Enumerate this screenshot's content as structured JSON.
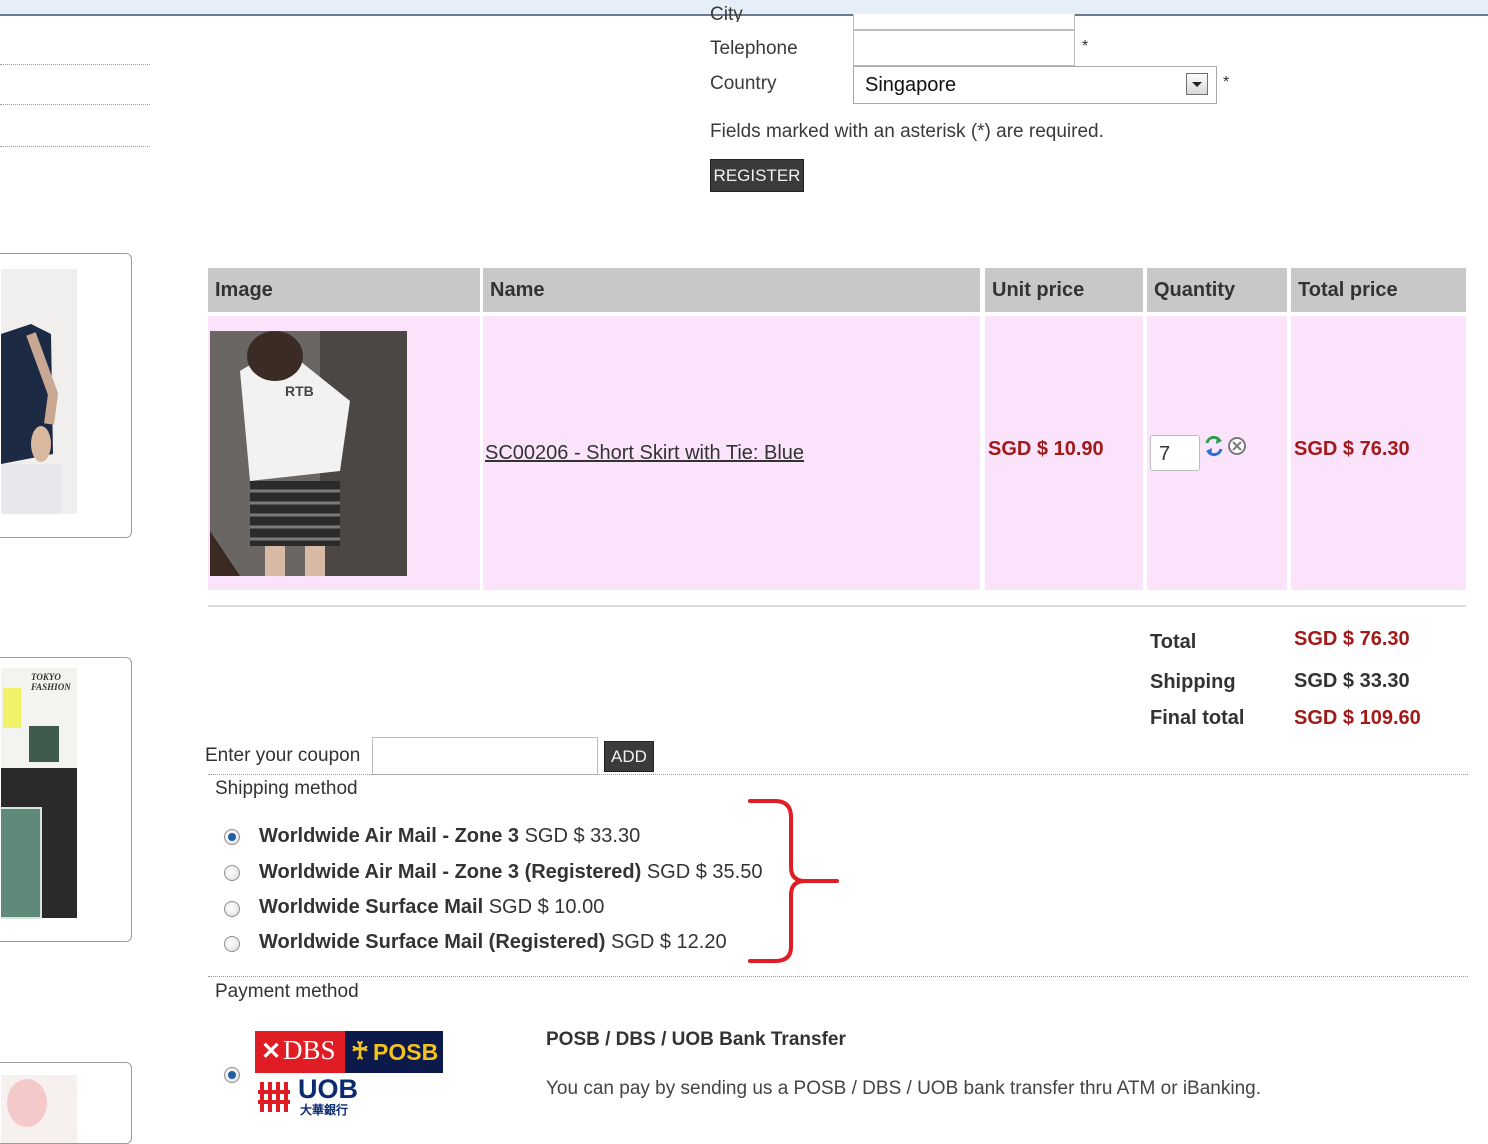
{
  "form": {
    "city_label": "City",
    "telephone_label": "Telephone",
    "country_label": "Country",
    "country_value": "Singapore",
    "required_star": "*",
    "required_note": "Fields marked with an asterisk (*) are required.",
    "register_label": "REGISTER"
  },
  "cart": {
    "headers": [
      "Image",
      "Name",
      "Unit price",
      "Quantity",
      "Total price"
    ],
    "item": {
      "name": "SC00206 - Short Skirt with Tie: Blue",
      "unit_price": "SGD $ 10.90",
      "quantity": "7",
      "total_price": "SGD $ 76.30"
    },
    "totals": {
      "total_label": "Total",
      "total_value": "SGD $ 76.30",
      "shipping_label": "Shipping",
      "shipping_value": "SGD $ 33.30",
      "final_label": "Final total",
      "final_value": "SGD $ 109.60"
    }
  },
  "coupon": {
    "label": "Enter your coupon",
    "value": "",
    "add_label": "ADD"
  },
  "shipping": {
    "title": "Shipping method",
    "options": [
      {
        "name": "Worldwide Air Mail - Zone 3",
        "price": "SGD $ 33.30",
        "selected": true
      },
      {
        "name": "Worldwide Air Mail - Zone 3 (Registered)",
        "price": "SGD $ 35.50",
        "selected": false
      },
      {
        "name": "Worldwide Surface Mail",
        "price": "SGD $ 10.00",
        "selected": false
      },
      {
        "name": "Worldwide Surface Mail (Registered)",
        "price": "SGD $ 12.20",
        "selected": false
      }
    ]
  },
  "payment": {
    "title": "Payment method",
    "option_title": "POSB / DBS / UOB Bank Transfer",
    "option_desc": "You can pay by sending us a POSB / DBS / UOB bank transfer thru ATM or iBanking.",
    "logo_dbs": "DBS",
    "logo_posb": "POSB",
    "logo_uob": "UOB",
    "logo_uob_cn": "大華銀行",
    "selected": true
  },
  "colors": {
    "price_red": "#a11a1a",
    "row_pink": "#fbe3fb",
    "header_grey": "#c8c8c8",
    "annotation_red": "#e01c24"
  }
}
